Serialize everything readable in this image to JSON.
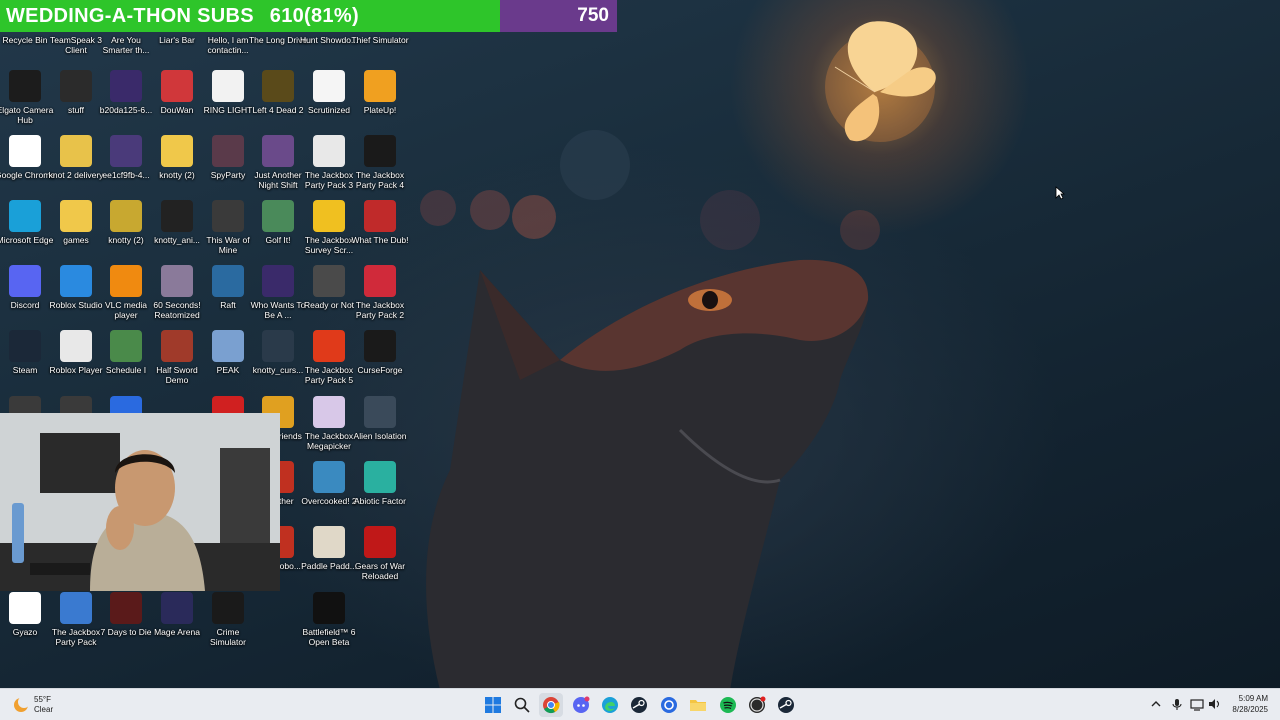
{
  "overlay": {
    "title": "WEDDING-A-THON SUBS",
    "progress": "610(81%)",
    "goal": "750"
  },
  "desktop_icons": [
    {
      "label": "Recycle Bin",
      "icon": "recycle-bin-icon",
      "color": "#6a7c8a"
    },
    {
      "label": "TeamSpeak 3 Client",
      "icon": "teamspeak-icon",
      "color": "#2a5a9a"
    },
    {
      "label": "Are You Smarter th...",
      "icon": "game-icon",
      "color": "#2a7ad0"
    },
    {
      "label": "Liar's Bar",
      "icon": "game-icon",
      "color": "#6a3a2a"
    },
    {
      "label": "Hello, I am contactin...",
      "icon": "game-icon",
      "color": "#8a8aa0"
    },
    {
      "label": "The Long Drive",
      "icon": "game-icon",
      "color": "#5a7a3a"
    },
    {
      "label": "Hunt Showdo...",
      "icon": "game-icon",
      "color": "#3a2a2a"
    },
    {
      "label": "Thief Simulator",
      "icon": "game-icon",
      "color": "#2a3a4a"
    },
    {
      "label": "Elgato Camera Hub",
      "icon": "camera-icon",
      "color": "#1c1c1c"
    },
    {
      "label": "stuff",
      "icon": "folder-icon",
      "color": "#2b2b2b"
    },
    {
      "label": "b20da125-6...",
      "icon": "file-icon",
      "color": "#3a2a6a"
    },
    {
      "label": "DouWan",
      "icon": "douwan-icon",
      "color": "#d0373a"
    },
    {
      "label": "RING LIGHT",
      "icon": "document-icon",
      "color": "#f2f2f2"
    },
    {
      "label": "Left 4 Dead 2",
      "icon": "game-icon",
      "color": "#5a4a1a"
    },
    {
      "label": "Scrutinized",
      "icon": "document-icon",
      "color": "#f5f5f5"
    },
    {
      "label": "PlateUp!",
      "icon": "game-icon",
      "color": "#f0a020"
    },
    {
      "label": "Google Chrome",
      "icon": "chrome-icon",
      "color": "#ffffff"
    },
    {
      "label": "knot 2 delivery",
      "icon": "folder-icon",
      "color": "#e8c24a"
    },
    {
      "label": "ee1cf9fb-4...",
      "icon": "file-icon",
      "color": "#4a3a7a"
    },
    {
      "label": "knotty (2)",
      "icon": "folder-icon",
      "color": "#f0c84a"
    },
    {
      "label": "SpyParty",
      "icon": "game-icon",
      "color": "#5a3a4a"
    },
    {
      "label": "Just Another Night Shift",
      "icon": "game-icon",
      "color": "#6a4a8a"
    },
    {
      "label": "The Jackbox Party Pack 3",
      "icon": "game-icon",
      "color": "#e8e8e8"
    },
    {
      "label": "The Jackbox Party Pack 4",
      "icon": "game-icon",
      "color": "#1a1a1a"
    },
    {
      "label": "Microsoft Edge",
      "icon": "edge-icon",
      "color": "#1aa0d8"
    },
    {
      "label": "games",
      "icon": "folder-icon",
      "color": "#f0c84a"
    },
    {
      "label": "knotty (2)",
      "icon": "folder-icon",
      "color": "#c8a830"
    },
    {
      "label": "knotty_ani...",
      "icon": "file-icon",
      "color": "#222222"
    },
    {
      "label": "This War of Mine",
      "icon": "game-icon",
      "color": "#3a3a3a"
    },
    {
      "label": "Golf It!",
      "icon": "game-icon",
      "color": "#4a8a5a"
    },
    {
      "label": "The Jackbox Survey Scr...",
      "icon": "game-icon",
      "color": "#f0c020"
    },
    {
      "label": "What The Dub!",
      "icon": "game-icon",
      "color": "#c02a2a"
    },
    {
      "label": "Discord",
      "icon": "discord-icon",
      "color": "#5865f2"
    },
    {
      "label": "Roblox Studio",
      "icon": "roblox-studio-icon",
      "color": "#2a8ae0"
    },
    {
      "label": "VLC media player",
      "icon": "vlc-icon",
      "color": "#f08a10"
    },
    {
      "label": "60 Seconds! Reatomized",
      "icon": "game-icon",
      "color": "#8a7a9a"
    },
    {
      "label": "Raft",
      "icon": "game-icon",
      "color": "#2a6aa0"
    },
    {
      "label": "Who Wants To Be A ...",
      "icon": "game-icon",
      "color": "#3a2a6a"
    },
    {
      "label": "Ready or Not",
      "icon": "game-icon",
      "color": "#4a4a4a"
    },
    {
      "label": "The Jackbox Party Pack 2",
      "icon": "game-icon",
      "color": "#d02a3a"
    },
    {
      "label": "Steam",
      "icon": "steam-icon",
      "color": "#1b2838"
    },
    {
      "label": "Roblox Player",
      "icon": "roblox-icon",
      "color": "#e8e8e8"
    },
    {
      "label": "Schedule I",
      "icon": "game-icon",
      "color": "#4a8a4a"
    },
    {
      "label": "Half Sword Demo",
      "icon": "game-icon",
      "color": "#a03a2a"
    },
    {
      "label": "PEAK",
      "icon": "game-icon",
      "color": "#7aa0d0"
    },
    {
      "label": "knotty_curs...",
      "icon": "file-icon",
      "color": "#2a3a4a"
    },
    {
      "label": "The Jackbox Party Pack 5",
      "icon": "game-icon",
      "color": "#e03a1a"
    },
    {
      "label": "CurseForge",
      "icon": "curseforge-icon",
      "color": "#1a1a1a"
    },
    {
      "label": "",
      "icon": "obs-icon",
      "color": "#3a3a3a"
    },
    {
      "label": "",
      "icon": "app-icon",
      "color": "#3a3a3a"
    },
    {
      "label": "",
      "icon": "app-icon",
      "color": "#2a6ae0"
    },
    {
      "label": "",
      "icon": "uno-icon",
      "color": "#d02020"
    },
    {
      "label": "With Friends",
      "icon": "game-icon",
      "color": "#e0a020"
    },
    {
      "label": "The Jackbox Megapicker",
      "icon": "game-icon",
      "color": "#d8c8e8"
    },
    {
      "label": "Alien Isolation",
      "icon": "game-icon",
      "color": "#3a4a5a"
    },
    {
      "label": "ned ther",
      "icon": "game-icon",
      "color": "#c03020"
    },
    {
      "label": "Overcooked! 2",
      "icon": "game-icon",
      "color": "#3a8ac0"
    },
    {
      "label": "Abiotic Factor",
      "icon": "game-icon",
      "color": "#2ab0a0"
    },
    {
      "label": "alking obo...",
      "icon": "game-icon",
      "color": "#c03020"
    },
    {
      "label": "Paddle Padd...",
      "icon": "game-icon",
      "color": "#e0d8c8"
    },
    {
      "label": "Gears of War Reloaded",
      "icon": "game-icon",
      "color": "#c01818"
    },
    {
      "label": "Gyazo",
      "icon": "gyazo-icon",
      "color": "#ffffff"
    },
    {
      "label": "The Jackbox Party Pack",
      "icon": "game-icon",
      "color": "#3a7ad0"
    },
    {
      "label": "7 Days to Die",
      "icon": "game-icon",
      "color": "#5a1a1a"
    },
    {
      "label": "Mage Arena",
      "icon": "game-icon",
      "color": "#2a2a5a"
    },
    {
      "label": "Crime Simulator",
      "icon": "game-icon",
      "color": "#1a1a1a"
    },
    {
      "label": "Battlefield™ 6 Open Beta",
      "icon": "game-icon",
      "color": "#111111"
    }
  ],
  "taskbar": {
    "weather_temp": "55°F",
    "weather_cond": "Clear",
    "time": "5:09 AM",
    "date": "8/28/2025",
    "apps": [
      "windows-start-icon",
      "search-icon",
      "chrome-icon",
      "discord-icon",
      "edge-icon",
      "steam-icon",
      "gyazo-icon",
      "file-explorer-icon",
      "spotify-icon",
      "obs-icon",
      "steam-icon"
    ]
  }
}
